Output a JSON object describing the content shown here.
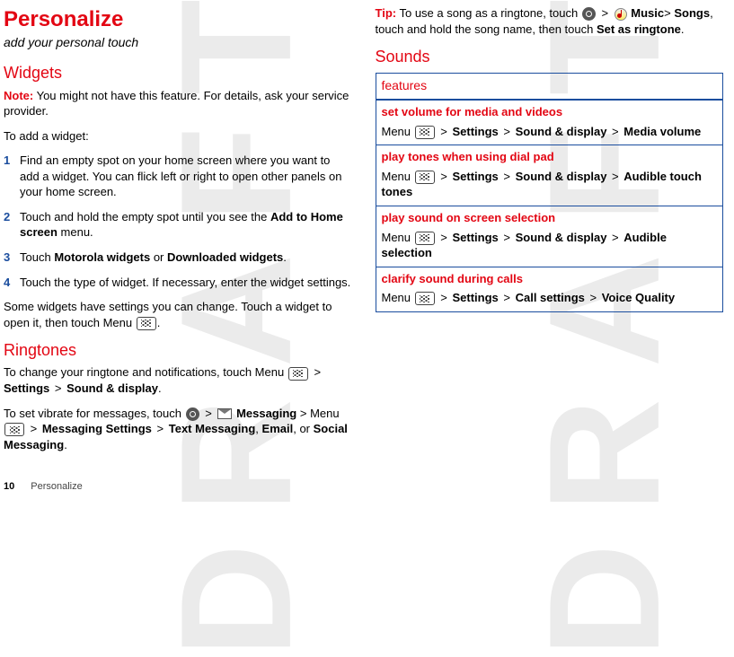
{
  "watermark": "DRAFT",
  "left": {
    "title": "Personalize",
    "subtitle": "add your personal touch",
    "widgets": {
      "heading": "Widgets",
      "note_label": "Note:",
      "note_text": " You might not have this feature. For details, ask your service provider.",
      "intro": "To add a widget:",
      "steps": {
        "1": {
          "num": "1",
          "text": "Find an empty spot on your home screen where you want to add a widget. You can flick left or right to open other panels on your home screen."
        },
        "2": {
          "num": "2",
          "text_a": "Touch and hold the empty spot until you see the ",
          "bold": "Add to Home screen",
          "text_b": " menu."
        },
        "3": {
          "num": "3",
          "text_a": "Touch ",
          "bold_a": "Motorola widgets",
          "or": " or ",
          "bold_b": "Downloaded widgets",
          "text_b": "."
        },
        "4": {
          "num": "4",
          "text": "Touch the type of widget. If necessary, enter the widget settings."
        }
      },
      "outro_a": "Some widgets have settings you can change. Touch a widget to open it, then touch Menu ",
      "outro_b": "."
    },
    "ringtones": {
      "heading": "Ringtones",
      "para1_a": "To change your ringtone and notifications, touch Menu ",
      "para1_b": " > ",
      "para1_c": "Settings",
      "para1_d": " > ",
      "para1_e": "Sound & display",
      "para1_f": ".",
      "para2_a": "To set vibrate for messages, touch ",
      "para2_b": " > ",
      "para2_c": "Messaging",
      "para2_d": " > Menu ",
      "para2_e": " > ",
      "para2_f": "Messaging Settings",
      "para2_g": " > ",
      "para2_h": "Text Messaging",
      "para2_i": ", ",
      "para2_j": "Email",
      "para2_k": ", or ",
      "para2_l": "Social Messaging",
      "para2_m": "."
    }
  },
  "right": {
    "tip": {
      "label": "Tip:",
      "a": " To use a song as a ringtone, touch ",
      "b": " > ",
      "c": "Music",
      "d": "> ",
      "e": "Songs",
      "f": ", touch and hold the song name, then touch ",
      "g": "Set as ringtone",
      "h": "."
    },
    "sounds": {
      "heading": "Sounds",
      "header": "features",
      "rows": {
        "0": {
          "label": "set volume for media and videos",
          "path_a": "Menu ",
          "path_b": " > ",
          "path_c": "Settings",
          "path_d": " > ",
          "path_e": "Sound & display",
          "path_f": " > ",
          "path_g": "Media volume"
        },
        "1": {
          "label": "play tones when using dial pad",
          "path_a": "Menu ",
          "path_b": " > ",
          "path_c": "Settings",
          "path_d": " > ",
          "path_e": "Sound & display",
          "path_f": " > ",
          "path_g": "Audible touch tones"
        },
        "2": {
          "label": "play sound on screen selection",
          "path_a": "Menu ",
          "path_b": " > ",
          "path_c": "Settings",
          "path_d": " > ",
          "path_e": "Sound & display",
          "path_f": " > ",
          "path_g": "Audible selection"
        },
        "3": {
          "label": "clarify sound during calls",
          "path_a": "Menu ",
          "path_b": " > ",
          "path_c": "Settings",
          "path_d": " > ",
          "path_e": "Call settings",
          "path_f": " > ",
          "path_g": "Voice Quality"
        }
      }
    }
  },
  "footer": {
    "pagenum": "10",
    "section": "Personalize"
  }
}
